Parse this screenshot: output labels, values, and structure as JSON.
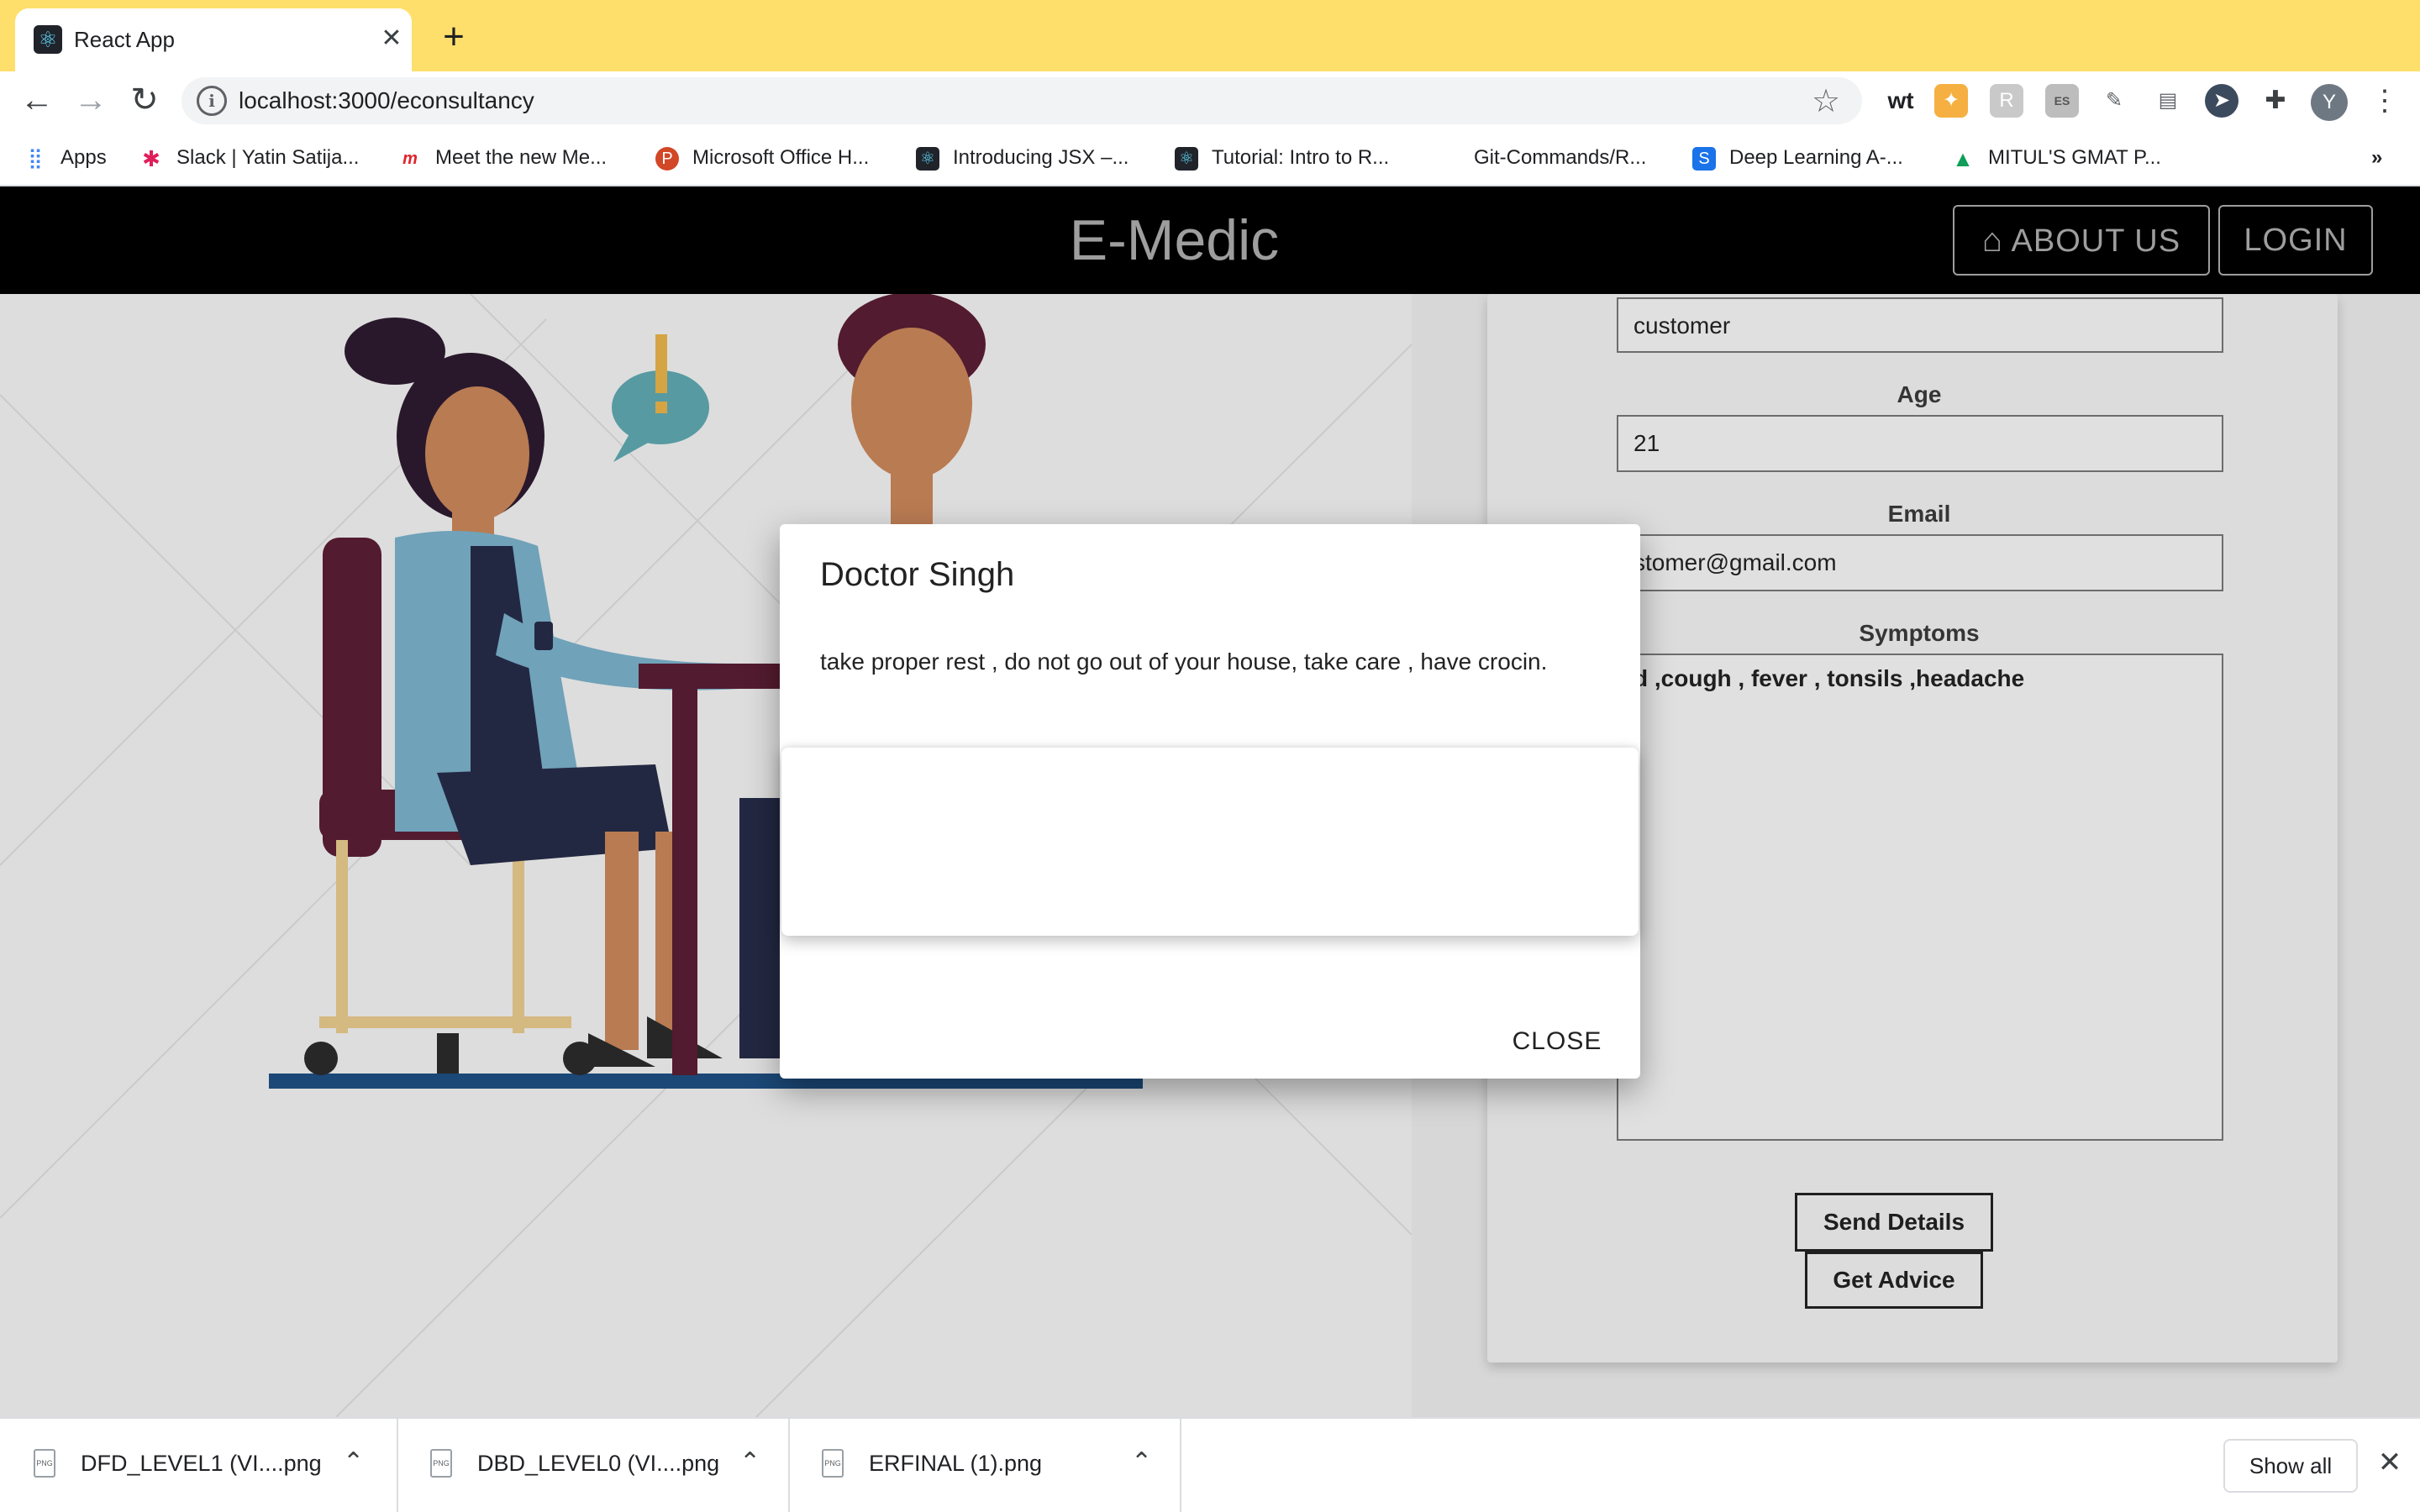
{
  "browser": {
    "tab_title": "React App",
    "url": "localhost:3000/econsultancy",
    "extensions": [
      "wt",
      "ES"
    ],
    "profile_initial": "Y",
    "bookmarks": [
      "Apps",
      "Slack | Yatin Satija...",
      "Meet the new Me...",
      "Microsoft Office H...",
      "Introducing JSX –...",
      "Tutorial: Intro to R...",
      "Git-Commands/R...",
      "Deep Learning A-...",
      "MITUL'S GMAT P..."
    ],
    "bookmarks_overflow": "»"
  },
  "app": {
    "brand": "E-Medic",
    "nav": {
      "about": "ABOUT US",
      "login": "LOGIN"
    }
  },
  "form": {
    "name_value": "customer",
    "age_label": "Age",
    "age_value": "21",
    "email_label": "Email",
    "email_value": "stomer@gmail.com",
    "symptoms_label": "Symptoms",
    "symptoms_value": "d ,cough , fever , tonsils ,headache",
    "send_button": "Send Details",
    "advice_button": "Get Advice"
  },
  "dialog": {
    "title": "Doctor Singh",
    "message": "take proper rest , do not go out of your house, take care , have crocin.",
    "close_label": "CLOSE"
  },
  "downloads": {
    "items": [
      "DFD_LEVEL1 (VI....png",
      "DBD_LEVEL0 (VI....png",
      "ERFINAL (1).png"
    ],
    "show_all": "Show all"
  },
  "colors": {
    "tabstrip": "#fedf6b",
    "appbar": "#000000",
    "nav_text": "#9e9e9e",
    "react_blue": "#61dafb"
  }
}
